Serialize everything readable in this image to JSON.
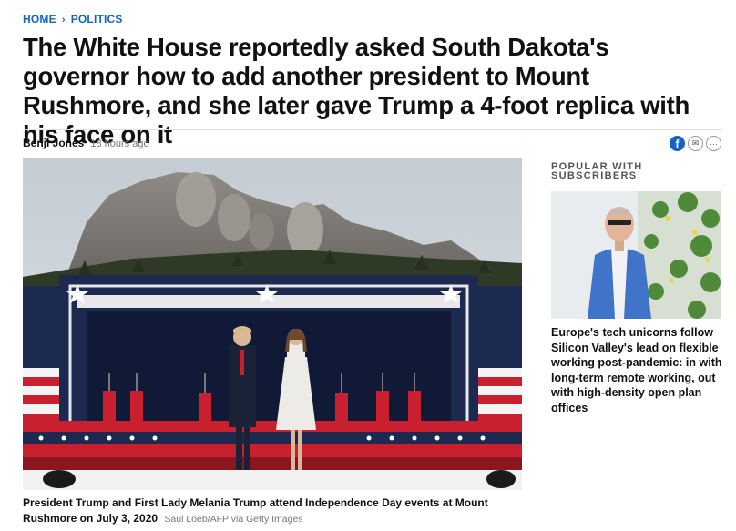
{
  "breadcrumb": {
    "home": "HOME",
    "separator": "›",
    "section": "POLITICS"
  },
  "article": {
    "headline": "The White House reportedly asked South Dakota's governor how to add another president to Mount Rushmore, and she later gave Trump a 4-foot replica with his face on it",
    "author": "Benji Jones",
    "time": "18 hours ago",
    "caption": "President Trump and First Lady Melania Trump attend Independence Day events at Mount Rushmore on July 3, 2020",
    "credit": "Saul Loeb/AFP via Getty Images"
  },
  "share": {
    "facebook_glyph": "f",
    "email_glyph": "✉",
    "more_glyph": "···"
  },
  "sidebar": {
    "title": "POPULAR WITH SUBSCRIBERS",
    "items": [
      {
        "title": "Europe's tech unicorns follow Silicon Valley's lead on flexible working post-pandemic: in with long-term remote working, out with high-density open plan offices"
      }
    ]
  },
  "colors": {
    "link_blue": "#1565c0",
    "stage_navy": "#1c2a52",
    "flag_red": "#c8202f"
  },
  "icons": [
    "facebook-icon",
    "email-icon",
    "more-icon"
  ]
}
